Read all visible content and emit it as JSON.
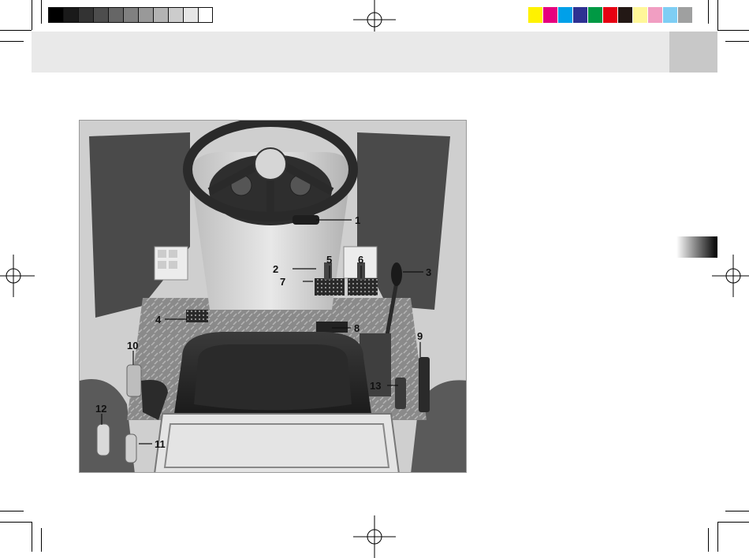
{
  "page": {
    "callouts": [
      "1",
      "2",
      "3",
      "4",
      "5",
      "6",
      "7",
      "8",
      "9",
      "10",
      "11",
      "12",
      "13"
    ]
  },
  "colors": {
    "grayscale": [
      "#000000",
      "#1a1a1a",
      "#333333",
      "#4d4d4d",
      "#666666",
      "#808080",
      "#999999",
      "#b3b3b3",
      "#cccccc",
      "#e6e6e6",
      "#ffffff"
    ],
    "process": [
      "#fff200",
      "#e6007e",
      "#00a0e9",
      "#2e3192",
      "#009944",
      "#e60012",
      "#231815",
      "#fff799",
      "#f19ec2",
      "#7ecef4",
      "#9fa0a0"
    ],
    "header_band": "#e9e9e9",
    "header_tab": "#c8c8c8"
  }
}
